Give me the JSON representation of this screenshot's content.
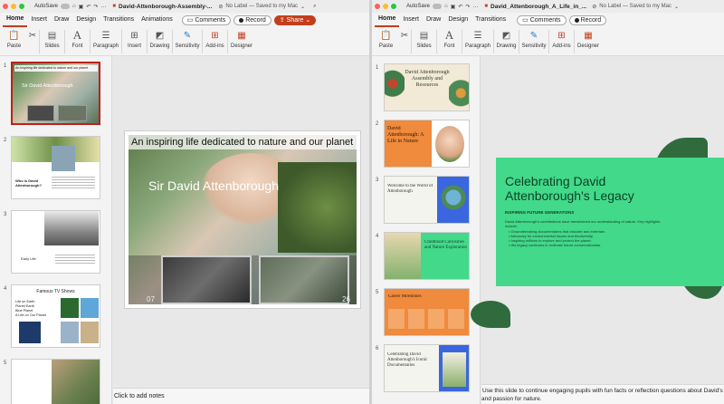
{
  "left": {
    "autosave_label": "AutoSave",
    "title": "David-Attenborough-Assembly-...",
    "label_status": "No Label — Saved to my Mac",
    "tabs": [
      "Home",
      "Insert",
      "Draw",
      "Design",
      "Transitions",
      "Animations"
    ],
    "comments_label": "Comments",
    "record_label": "Record",
    "share_label": "Share",
    "ribbon": [
      "Paste",
      "Slides",
      "Font",
      "Paragraph",
      "Insert",
      "Drawing",
      "Sensitivity",
      "Add-ins",
      "Designer"
    ],
    "slide_numbers": [
      "1",
      "2",
      "3",
      "4",
      "5"
    ],
    "thumb1": {
      "header": "An inspiring life dedicated to nature and our planet",
      "name": "Sir David Attenborough"
    },
    "thumb2": {
      "heading": "Who is David Attenborough?"
    },
    "thumb3": {
      "heading": "Early Life"
    },
    "thumb4": {
      "heading": "Famous TV Shows",
      "bullets": [
        "Life on Earth",
        "Planet Earth",
        "Blue Planet",
        "A Life on Our Planet"
      ]
    },
    "slide": {
      "header": "An inspiring life dedicated to nature and our planet",
      "name": "Sir David Attenborough",
      "num_left": "07",
      "num_right": "26"
    },
    "notes_placeholder": "Click to add notes"
  },
  "right": {
    "autosave_label": "AutoSave",
    "title": "David_Attenborough_A_Life_in_...",
    "label_status": "No Label — Saved to my Mac",
    "tabs": [
      "Home",
      "Insert",
      "Draw",
      "Design",
      "Transitions"
    ],
    "comments_label": "Comments",
    "record_label": "Record",
    "ribbon": [
      "Paste",
      "Slides",
      "Font",
      "Paragraph",
      "Drawing",
      "Sensitivity",
      "Add-ins",
      "Designer"
    ],
    "slide_numbers": [
      "1",
      "2",
      "3",
      "4",
      "5",
      "6"
    ],
    "thumbs": [
      "David Attenborough Assembly and Resources",
      "David Attenborough: A Life in Nature",
      "Welcome to the World of Attenborough",
      "Childhood Curiosities and Nature Exploration",
      "Career Milestones",
      "Celebrating David Attenborough's Iconic Documentaries"
    ],
    "slide": {
      "title": "Celebrating David Attenborough's Legacy",
      "subtitle": "INSPIRING FUTURE GENERATIONS",
      "intro": "David Attenborough's contributions have transformed our understanding of nature. Key highlights include:",
      "bullets": [
        "Groundbreaking documentaries that educate and entertain.",
        "Advocacy for environmental issues and biodiversity.",
        "Inspiring millions to explore and protect the planet.",
        "His legacy continues to motivate future conservationists."
      ]
    },
    "notes_text": "Use this slide to continue engaging pupils with fun facts or reflection questions about David's and passion for nature."
  },
  "colors": {
    "accent": "#c43e1c",
    "slide_green": "#42d98a",
    "thumb_orange": "#f08a3c",
    "thumb_blue": "#3a66e0"
  }
}
